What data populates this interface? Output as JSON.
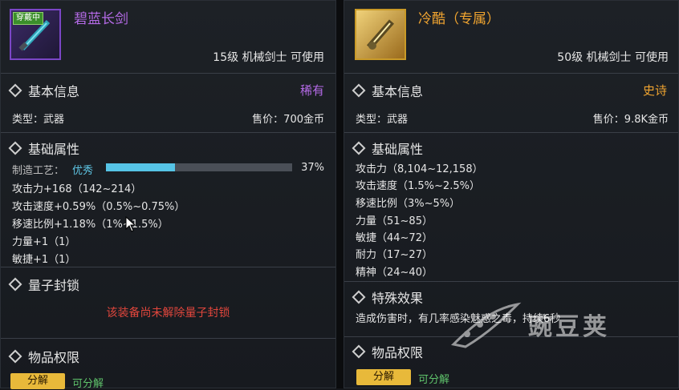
{
  "left": {
    "badge": "穿戴中",
    "name": "碧蓝长剑",
    "requirement": "15级 机械剑士 可使用",
    "basic_info_header": "基本信息",
    "rarity": "稀有",
    "type": "类型：武器",
    "price": "售价：700金币",
    "attr_header": "基础属性",
    "craft_label": "制造工艺：",
    "craft_quality": "优秀",
    "craft_percent": "37%",
    "craft_fraction": 0.37,
    "attributes": [
      "攻击力+168（142~214）",
      "攻击速度+0.59%（0.5%~0.75%）",
      "移速比例+1.18%（1%~1.5%）",
      "力量+1（1）",
      "敏捷+1（1）"
    ],
    "quantum_header": "量子封锁",
    "quantum_text": "该装备尚未解除量子封锁",
    "perm_header": "物品权限",
    "decompose_button": "分解",
    "decompose_note": "可分解"
  },
  "right": {
    "name": "冷酷（专属）",
    "requirement": "50级 机械剑士 可使用",
    "basic_info_header": "基本信息",
    "rarity": "史诗",
    "type": "类型：武器",
    "price": "售价：9.8K金币",
    "attr_header": "基础属性",
    "attributes": [
      "攻击力（8,104~12,158）",
      "攻击速度（1.5%~2.5%）",
      "移速比例（3%~5%）",
      "力量（51~85）",
      "敏捷（44~72）",
      "耐力（17~27）",
      "精神（24~40）"
    ],
    "effect_header": "特殊效果",
    "effect_text": "造成伤害时，有几率感染魅惑之毒，持续6秒",
    "perm_header": "物品权限",
    "decompose_button": "分解",
    "decompose_note": "可分解"
  },
  "watermark": "豌豆荚",
  "colors": {
    "rare": "#b46ae6",
    "epic": "#f0a430",
    "quality": "#5fc7e6",
    "seal_red": "#e0463c",
    "decompose_green": "#5fc36b",
    "button_gold": "#e8b93a"
  },
  "icons": [
    "sword-icon",
    "golden-sword-icon",
    "diamond-icon",
    "cursor-icon",
    "watermark-logo-icon"
  ]
}
